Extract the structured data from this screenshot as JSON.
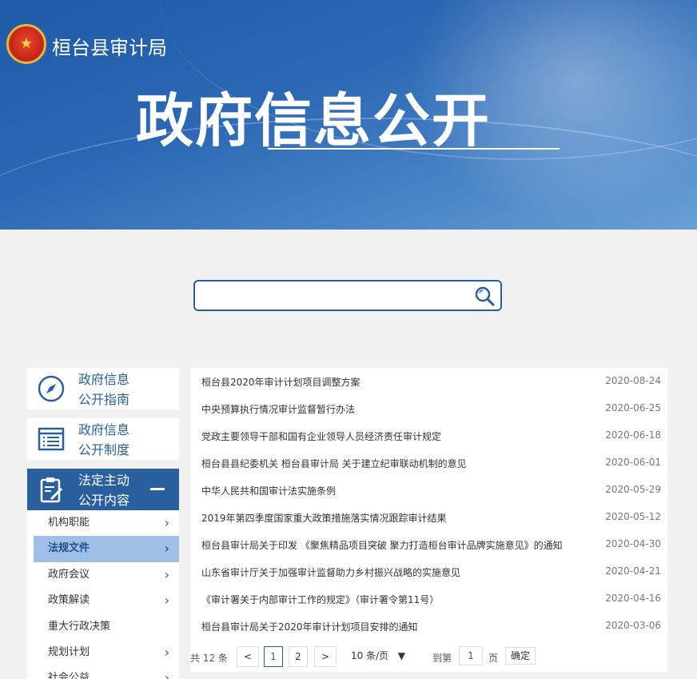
{
  "header": {
    "org_name": "桓台县审计局",
    "title": "政府信息公开"
  },
  "search": {
    "placeholder": ""
  },
  "sidebar": {
    "cards": [
      {
        "label_line1": "政府信息",
        "label_line2": "公开指南",
        "icon": "compass-icon"
      },
      {
        "label_line1": "政府信息",
        "label_line2": "公开制度",
        "icon": "list-icon"
      },
      {
        "label_line1": "法定主动",
        "label_line2": "公开内容",
        "icon": "clipboard-edit-icon"
      }
    ],
    "sub_items": [
      {
        "label": "机构职能",
        "has_chevron": true
      },
      {
        "label": "法规文件",
        "has_chevron": true,
        "active": true
      },
      {
        "label": "政府会议",
        "has_chevron": true
      },
      {
        "label": "政策解读",
        "has_chevron": true
      },
      {
        "label": "重大行政决策",
        "has_chevron": false
      },
      {
        "label": "规划计划",
        "has_chevron": true
      },
      {
        "label": "社会公益",
        "has_chevron": true
      }
    ]
  },
  "articles": [
    {
      "title": "桓台县2020年审计计划项目调整方案",
      "date": "2020-08-24"
    },
    {
      "title": "中央预算执行情况审计监督暂行办法",
      "date": "2020-06-25"
    },
    {
      "title": "党政主要领导干部和国有企业领导人员经济责任审计规定",
      "date": "2020-06-18"
    },
    {
      "title": "桓台县县纪委机关 桓台县审计局 关于建立纪审联动机制的意见",
      "date": "2020-06-01"
    },
    {
      "title": "中华人民共和国审计法实施条例",
      "date": "2020-05-29"
    },
    {
      "title": "2019年第四季度国家重大政策措施落实情况跟踪审计结果",
      "date": "2020-05-12"
    },
    {
      "title": "桓台县审计局关于印发 《聚焦精品项目突破 聚力打造桓台审计品牌实施意见》的通知",
      "date": "2020-04-30"
    },
    {
      "title": "山东省审计厅关于加强审计监督助力乡村振兴战略的实施意见",
      "date": "2020-04-21"
    },
    {
      "title": "《审计署关于内部审计工作的规定》（审计署令第11号）",
      "date": "2020-04-16"
    },
    {
      "title": "桓台县审计局关于2020年审计计划项目安排的通知",
      "date": "2020-03-06"
    }
  ],
  "pager": {
    "total": "共 12 条",
    "prev": "<",
    "page1": "1",
    "page2": "2",
    "next": ">",
    "page_size": "10 条/页",
    "goto_prefix": "到第",
    "goto_value": "1",
    "goto_suffix": "页",
    "confirm": "确定"
  },
  "colors": {
    "primary": "#2a5f9e",
    "active_sub_bg": "#9fbfe6"
  }
}
